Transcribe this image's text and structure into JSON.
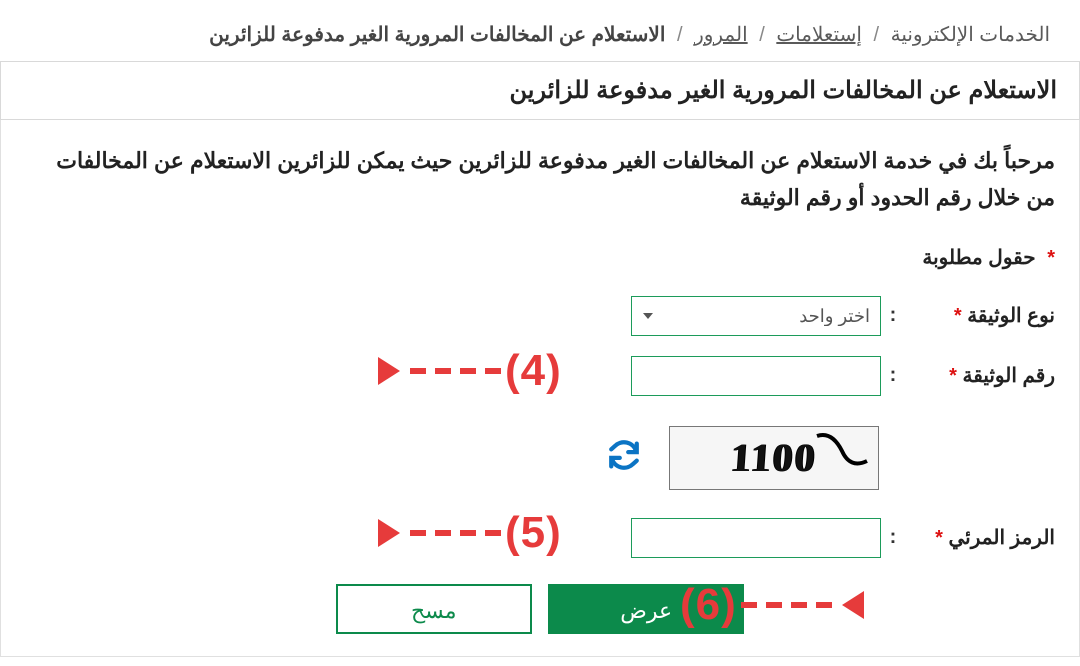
{
  "breadcrumb": {
    "c1": "الخدمات الإلكترونية",
    "c2": "إستعلامات",
    "c3": "المرور",
    "c4": "الاستعلام عن المخالفات المرورية الغير مدفوعة للزائرين"
  },
  "panel": {
    "title": "الاستعلام عن المخالفات المرورية الغير مدفوعة للزائرين",
    "intro": "مرحباً بك في خدمة الاستعلام عن المخالفات الغير مدفوعة للزائرين حيث يمكن للزائرين الاستعلام عن المخالفات من خلال رقم الحدود أو رقم الوثيقة",
    "required_label": "حقول مطلوبة"
  },
  "form": {
    "doc_type_label": "نوع الوثيقة",
    "doc_type_option": "اختر واحد",
    "doc_number_label": "رقم الوثيقة",
    "doc_number_value": "",
    "captcha_label": "الرمز المرئي",
    "captcha_value": "",
    "captcha_image_text": "1100"
  },
  "buttons": {
    "submit": "عرض",
    "clear": "مسح"
  },
  "annotations": {
    "a4": "(4)",
    "a5": "(5)",
    "a6": "(6)"
  }
}
